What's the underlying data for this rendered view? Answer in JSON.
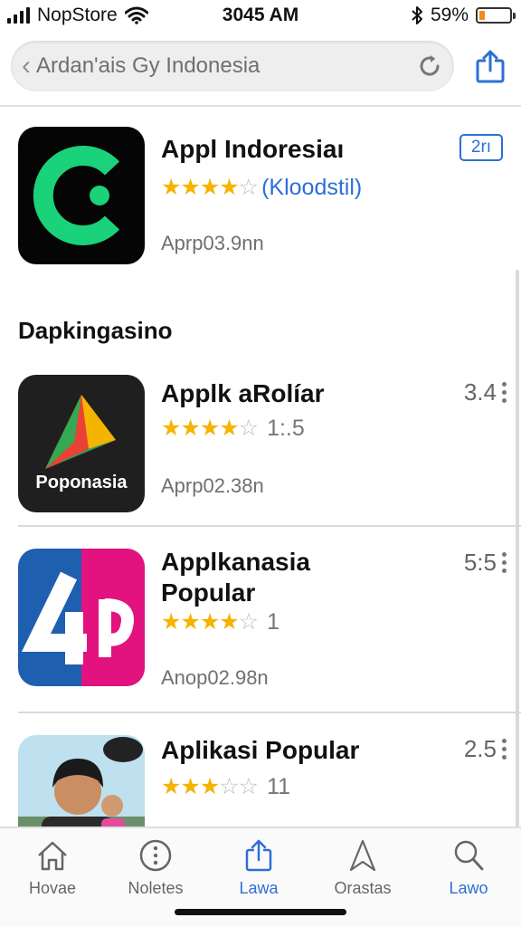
{
  "status_bar": {
    "carrier": "NopStore",
    "time": "3045 AM",
    "battery": "59%",
    "battery_level": 0.2
  },
  "search": {
    "query": "Ardan'ais Gy Indonesia"
  },
  "featured_app": {
    "title": "Appl Indoresiaı",
    "stars": 4,
    "rating_text": "(Kloodstil)",
    "size": "Aprp03.9nn",
    "badge": "2rı",
    "icon_bg": "#050505",
    "icon_accent": "#19d27a"
  },
  "section": {
    "title": "Dapkingasino"
  },
  "apps": [
    {
      "title": "Applk aRolíar",
      "stars": 4,
      "rating_count": "1:.5",
      "size": "Aprp02.38n",
      "score": "3.4",
      "icon_caption": "Poponasia"
    },
    {
      "title_line1": "Applkanasia",
      "title_line2": "Popular",
      "stars": 4,
      "rating_count": "1",
      "size": "Anop02.98n",
      "score": "5:5"
    },
    {
      "title": "Aplikasi Popular",
      "stars": 3,
      "rating_count": "11",
      "score": "2.5"
    }
  ],
  "tabs": [
    {
      "label": "Hovae",
      "icon": "home-icon"
    },
    {
      "label": "Noletes",
      "icon": "info-icon"
    },
    {
      "label": "Lawa",
      "icon": "share-icon",
      "active": true
    },
    {
      "label": "Orastas",
      "icon": "compass-icon"
    },
    {
      "label": "Lawo",
      "icon": "search-icon",
      "active": true
    }
  ],
  "colors": {
    "accent": "#2d6fd6",
    "star": "#f4b400",
    "battery": "#f08a1c"
  }
}
